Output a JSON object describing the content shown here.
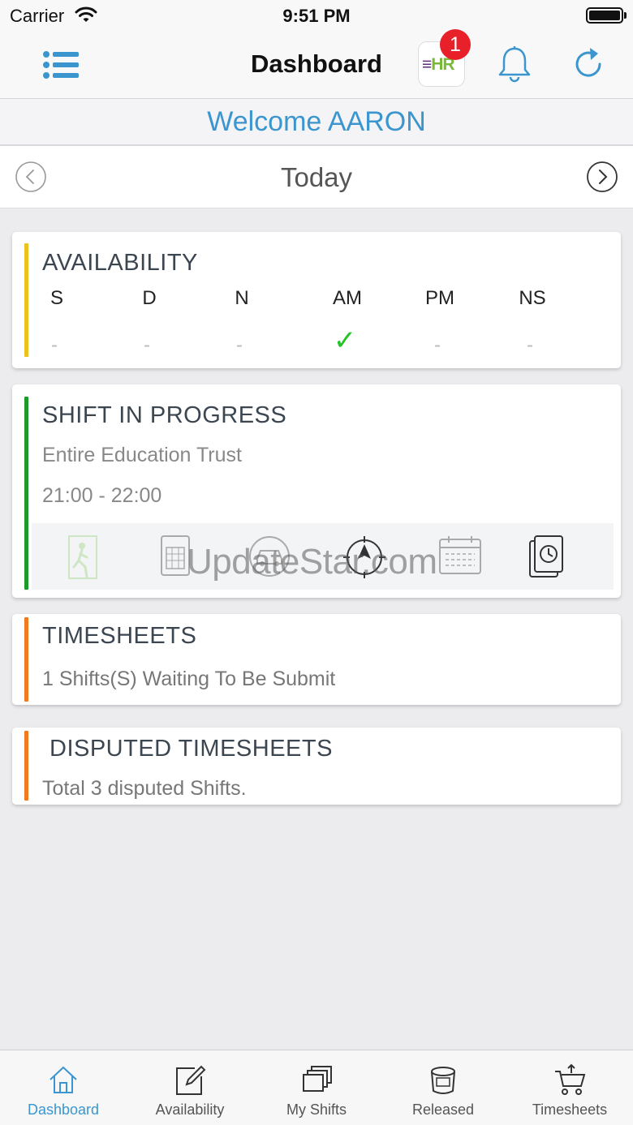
{
  "status_bar": {
    "carrier": "Carrier",
    "time": "9:51 PM"
  },
  "nav": {
    "title": "Dashboard",
    "app_badge_e": "≡",
    "app_badge_hr": "HR",
    "notification_count": "1"
  },
  "welcome": "Welcome AARON",
  "date_nav": {
    "label": "Today"
  },
  "availability": {
    "title": "AVAILABILITY",
    "accent_color": "#e9c21e",
    "columns": [
      {
        "label": "S",
        "value": "-"
      },
      {
        "label": "D",
        "value": "-"
      },
      {
        "label": "N",
        "value": "-"
      },
      {
        "label": "AM",
        "value": "✓"
      },
      {
        "label": "PM",
        "value": "-"
      },
      {
        "label": "NS",
        "value": "-"
      }
    ]
  },
  "shift_in_progress": {
    "title": "SHIFT IN PROGRESS",
    "accent_color": "#1d9b2a",
    "organisation": "Entire Education Trust",
    "time_range": "21:00 - 22:00",
    "actions": [
      "sign-in-icon",
      "building-icon",
      "car-icon",
      "navigation-icon",
      "calendar-icon",
      "timesheet-clock-icon"
    ]
  },
  "timesheets": {
    "title": "TIMESHEETS",
    "accent_color": "#f07a1f",
    "message": "1 Shifts(S) Waiting To Be Submit"
  },
  "disputed_timesheets": {
    "title": "DISPUTED TIMESHEETS",
    "accent_color": "#f07a1f",
    "message": "Total 3 disputed Shifts."
  },
  "watermark": "UpdateStar.com",
  "tab_bar": {
    "active": "Dashboard",
    "tabs": [
      {
        "label": "Dashboard",
        "icon": "home-icon"
      },
      {
        "label": "Availability",
        "icon": "edit-icon"
      },
      {
        "label": "My Shifts",
        "icon": "stack-icon"
      },
      {
        "label": "Released",
        "icon": "bucket-icon"
      },
      {
        "label": "Timesheets",
        "icon": "cart-icon"
      }
    ]
  },
  "colors": {
    "brand_blue": "#3b95cf",
    "check_green": "#22c426",
    "badge_red": "#e8202a"
  }
}
